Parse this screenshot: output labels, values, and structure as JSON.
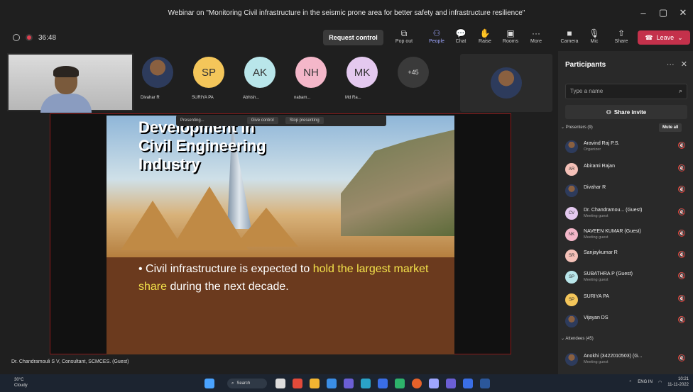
{
  "window": {
    "title": "Webinar on \"Monitoring Civil infrastructure in the seismic prone area for better safety and infrastructure resilience\""
  },
  "meeting": {
    "timer": "36:48",
    "request_control": "Request control",
    "leave": "Leave"
  },
  "toolbar": [
    {
      "label": "Pop out",
      "icon": "pop-out-icon"
    },
    {
      "label": "People",
      "icon": "people-icon"
    },
    {
      "label": "Chat",
      "icon": "chat-icon"
    },
    {
      "label": "Raise",
      "icon": "hand-icon"
    },
    {
      "label": "Rooms",
      "icon": "rooms-icon"
    },
    {
      "label": "More",
      "icon": "more-icon"
    },
    {
      "label": "Camera",
      "icon": "camera-off-icon"
    },
    {
      "label": "Mic",
      "icon": "mic-off-icon"
    },
    {
      "label": "Share",
      "icon": "share-icon"
    }
  ],
  "avatars": [
    {
      "initials": "",
      "name": "Divahar R",
      "color": "#4a5d7a"
    },
    {
      "initials": "SP",
      "name": "SURIYA PA",
      "color": "#f4c65a"
    },
    {
      "initials": "AK",
      "name": "Abhish...",
      "color": "#b9e6ea"
    },
    {
      "initials": "NH",
      "name": "nabam...",
      "color": "#f4b7c9"
    },
    {
      "initials": "MK",
      "name": "Md Ra...",
      "color": "#e4c9ef"
    },
    {
      "initials": "+45",
      "name": "",
      "color": "#3a3a3a"
    }
  ],
  "presenting": {
    "label": "Presenting...",
    "give_control": "Give control",
    "stop": "Stop presenting"
  },
  "slide": {
    "title_lines": [
      "Development in",
      "Civil Engineering",
      "Industry"
    ],
    "bullet_pre": "Civil infrastructure is expected to ",
    "bullet_hl": "hold the largest market share",
    "bullet_post": " during the next decade."
  },
  "caption": "Dr. Chandramouli S V, Consultant, SCMCES. (Guest)",
  "panel": {
    "title": "Participants",
    "search_placeholder": "Type a name",
    "share_invite": "Share invite",
    "presenters_label": "Presenters (9)",
    "mute_all": "Mute all",
    "attendees_label": "Attendees (45)",
    "participants": [
      {
        "initials": "",
        "name": "Aravind Raj P.S.",
        "sub": "Organizer",
        "color": "#6a4a3a"
      },
      {
        "initials": "AR",
        "name": "Abirami Rajan",
        "sub": "",
        "color": "#f5c1b8"
      },
      {
        "initials": "",
        "name": "Divahar R",
        "sub": "",
        "color": "#4a5d7a"
      },
      {
        "initials": "CV",
        "name": "Dr. Chandramou... (Guest)",
        "sub": "Meeting guest",
        "color": "#e4c9ef"
      },
      {
        "initials": "NK",
        "name": "NAVEEN KUMAR (Guest)",
        "sub": "Meeting guest",
        "color": "#f4b7c9"
      },
      {
        "initials": "SR",
        "name": "Sanjaykumar R",
        "sub": "",
        "color": "#f5c1b8"
      },
      {
        "initials": "SP",
        "name": "SUBATHRA P (Guest)",
        "sub": "Meeting guest",
        "color": "#b9e6ea"
      },
      {
        "initials": "SP",
        "name": "SURIYA PA",
        "sub": "",
        "color": "#f4c65a"
      },
      {
        "initials": "",
        "name": "Vijayan DS",
        "sub": "",
        "color": "#5a6a7a"
      },
      {
        "initials": "",
        "name": "Anokhi (3422010503) (G...",
        "sub": "Meeting guest",
        "color": "#888"
      }
    ]
  },
  "taskbar": {
    "temp": "30°C",
    "weather": "Cloudy",
    "search": "Search",
    "lang": "ENG IN",
    "time": "10:21",
    "date": "11-11-2022"
  }
}
